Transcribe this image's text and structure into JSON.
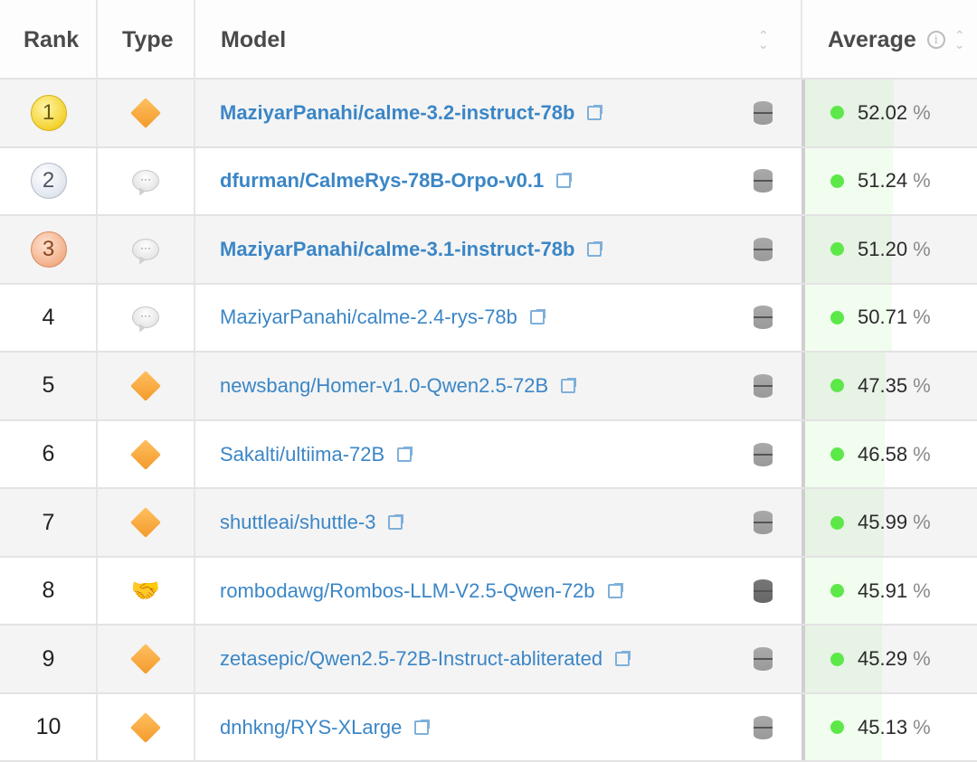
{
  "header": {
    "rank": "Rank",
    "type": "Type",
    "model": "Model",
    "average": "Average"
  },
  "rows": [
    {
      "rank": "1",
      "medal": "gold",
      "type_icon": "diamond",
      "model": "MaziyarPanahi/calme-3.2-instruct-78b",
      "bold": true,
      "avg": "52.02",
      "db": "light"
    },
    {
      "rank": "2",
      "medal": "silver",
      "type_icon": "chat",
      "model": "dfurman/CalmeRys-78B-Orpo-v0.1",
      "bold": true,
      "avg": "51.24",
      "db": "light"
    },
    {
      "rank": "3",
      "medal": "bronze",
      "type_icon": "chat",
      "model": "MaziyarPanahi/calme-3.1-instruct-78b",
      "bold": true,
      "avg": "51.20",
      "db": "light"
    },
    {
      "rank": "4",
      "type_icon": "chat",
      "model": "MaziyarPanahi/calme-2.4-rys-78b",
      "avg": "50.71",
      "db": "light"
    },
    {
      "rank": "5",
      "type_icon": "diamond",
      "model": "newsbang/Homer-v1.0-Qwen2.5-72B",
      "avg": "47.35",
      "db": "light"
    },
    {
      "rank": "6",
      "type_icon": "diamond",
      "model": "Sakalti/ultiima-72B",
      "avg": "46.58",
      "db": "light"
    },
    {
      "rank": "7",
      "type_icon": "diamond",
      "model": "shuttleai/shuttle-3",
      "avg": "45.99",
      "db": "light"
    },
    {
      "rank": "8",
      "type_icon": "handshake",
      "model": "rombodawg/Rombos-LLM-V2.5-Qwen-72b",
      "avg": "45.91",
      "db": "dark"
    },
    {
      "rank": "9",
      "type_icon": "diamond",
      "model": "zetasepic/Qwen2.5-72B-Instruct-abliterated",
      "avg": "45.29",
      "db": "light"
    },
    {
      "rank": "10",
      "type_icon": "diamond",
      "model": "dnhkng/RYS-XLarge",
      "avg": "45.13",
      "db": "light"
    }
  ],
  "pct_symbol": "%",
  "colors": {
    "link": "#3b86c6",
    "score_dot": "#5de84a"
  }
}
